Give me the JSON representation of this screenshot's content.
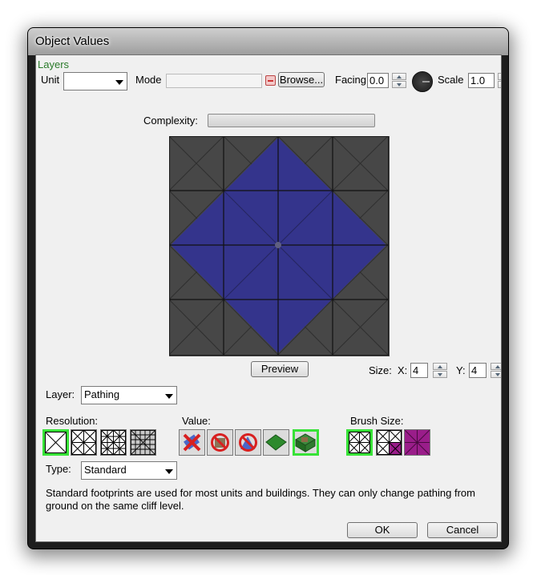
{
  "window": {
    "title": "Object Values"
  },
  "layers_heading": "Layers",
  "unit": {
    "label": "Unit",
    "value": ""
  },
  "mode": {
    "label": "Mode",
    "value": "",
    "browse_label": "Browse..."
  },
  "facing": {
    "label": "Facing",
    "value": "0.0"
  },
  "scale": {
    "label": "Scale",
    "value": "1.0"
  },
  "complexity": {
    "label": "Complexity:"
  },
  "preview_button": "Preview",
  "size": {
    "label": "Size:",
    "x_label": "X:",
    "x_value": "4",
    "y_label": "Y:",
    "y_value": "4"
  },
  "layer": {
    "label": "Layer:",
    "value": "Pathing"
  },
  "resolution": {
    "label": "Resolution:",
    "selected_index": 0
  },
  "value_tools": {
    "label": "Value:",
    "selected_index": 4
  },
  "brush": {
    "label": "Brush Size:",
    "selected_index": 0
  },
  "type": {
    "label": "Type:",
    "value": "Standard"
  },
  "description": "Standard footprints are used for most units and buildings.  They can only change pathing from ground on the same cliff level.",
  "ok_button": "OK",
  "cancel_button": "Cancel",
  "colors": {
    "footprint": "#34348c",
    "grid_bg": "#474747",
    "selected_border": "#37e237"
  }
}
